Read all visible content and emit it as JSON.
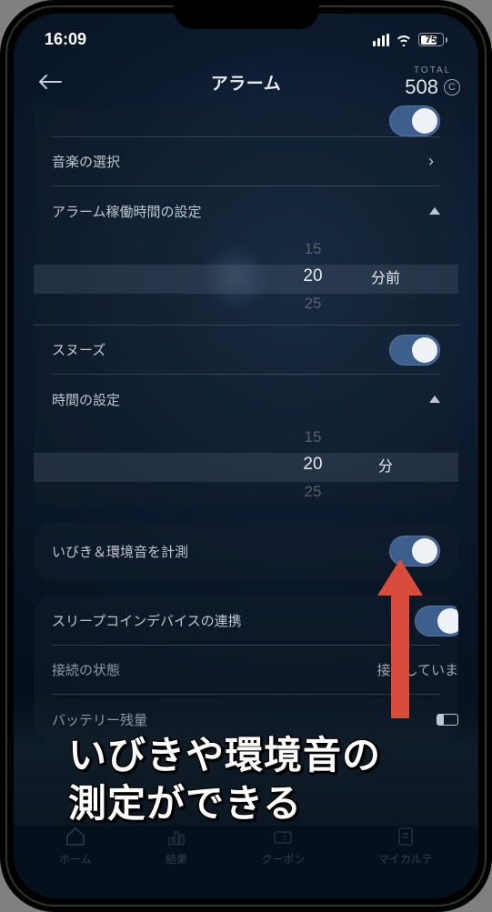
{
  "status": {
    "time": "16:09",
    "battery_pct": "75"
  },
  "header": {
    "title": "アラーム",
    "total_label": "TOTAL",
    "total_value": "508",
    "coin": "C"
  },
  "card1": {
    "row0_label": "",
    "music_label": "音楽の選択",
    "duration_label": "アラーム稼働時間の設定",
    "picker_ghost_top": "15",
    "picker_value": "20",
    "picker_ghost_bottom": "25",
    "picker_unit": "分前",
    "snooze_label": "スヌーズ",
    "time_set_label": "時間の設定",
    "picker2_ghost_top": "15",
    "picker2_value": "20",
    "picker2_ghost_bottom": "25",
    "picker2_unit": "分"
  },
  "card2": {
    "snoring_label": "いびき＆環境音を計測"
  },
  "card3": {
    "device_label": "スリープコインデバイスの連携",
    "conn_label": "接続の状態",
    "conn_value": "接続していま",
    "batt_label": "バッテリー残量"
  },
  "annotation": {
    "text": "いびきや環境音の\n測定ができる"
  },
  "tabs": {
    "home": "ホーム",
    "results": "結果",
    "coupon": "クーポン",
    "karte": "マイカルテ"
  }
}
